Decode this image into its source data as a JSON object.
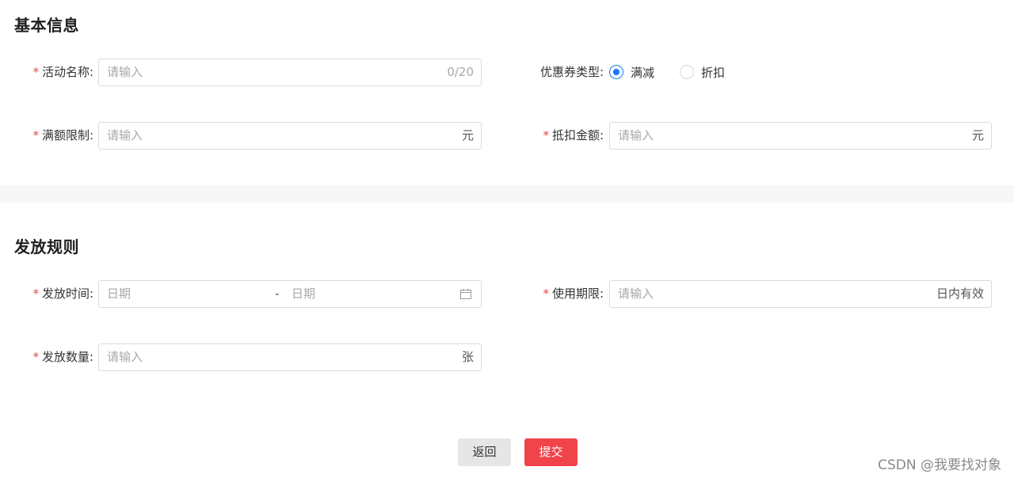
{
  "sections": {
    "basic_title": "基本信息",
    "rules_title": "发放规则"
  },
  "fields": {
    "activity_name": {
      "label": "活动名称:",
      "placeholder": "请输入",
      "counter": "0/20",
      "required": true
    },
    "coupon_type": {
      "label": "优惠券类型:",
      "options": [
        {
          "label": "满减",
          "checked": true
        },
        {
          "label": "折扣",
          "checked": false
        }
      ]
    },
    "amount_limit": {
      "label": "满额限制:",
      "placeholder": "请输入",
      "suffix": "元",
      "required": true
    },
    "deduction_amount": {
      "label": "抵扣金额:",
      "placeholder": "请输入",
      "suffix": "元",
      "required": true
    },
    "issue_time": {
      "label": "发放时间:",
      "start_placeholder": "日期",
      "separator": "-",
      "end_placeholder": "日期",
      "required": true
    },
    "validity_period": {
      "label": "使用期限:",
      "placeholder": "请输入",
      "suffix": "日内有效",
      "required": true
    },
    "issue_quantity": {
      "label": "发放数量:",
      "placeholder": "请输入",
      "suffix": "张",
      "required": true
    }
  },
  "required_mark": "*",
  "buttons": {
    "back": "返回",
    "submit": "提交"
  },
  "watermark": "CSDN @我要找对象",
  "colors": {
    "required": "#e84545",
    "radio_active": "#1677ff",
    "submit_bg": "#f0434a",
    "back_bg": "#e6e6e6"
  }
}
